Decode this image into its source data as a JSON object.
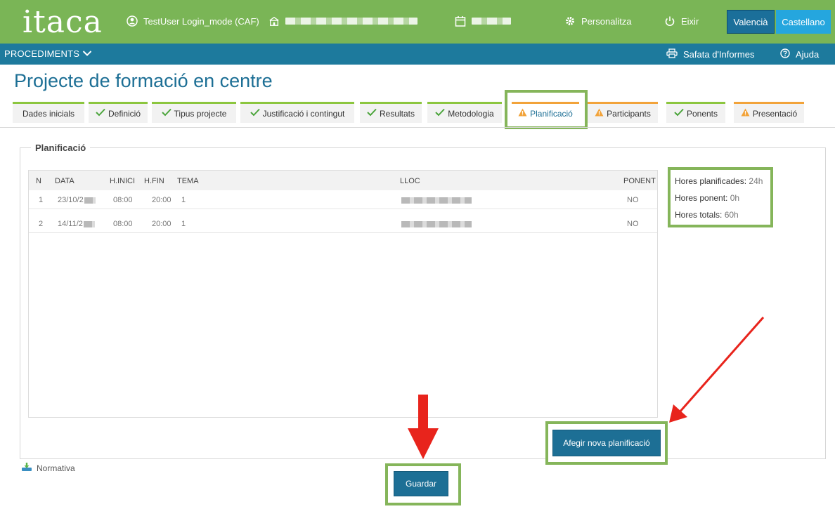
{
  "header": {
    "logo": "itaca",
    "user": "TestUser Login_mode (CAF)",
    "personalize": "Personalitza",
    "exit": "Eixir",
    "lang_valencia": "Valencià",
    "lang_castellano": "Castellano"
  },
  "nav": {
    "procediments": "PROCEDIMENTS",
    "reports": "Safata d'Informes",
    "help": "Ajuda"
  },
  "page": {
    "title": "Projecte de formació en centre"
  },
  "tabs": [
    {
      "label": "Dades inicials",
      "status": "none"
    },
    {
      "label": "Definició",
      "status": "ok"
    },
    {
      "label": "Tipus projecte",
      "status": "ok"
    },
    {
      "label": "Justificació i contingut",
      "status": "ok"
    },
    {
      "label": "Resultats",
      "status": "ok"
    },
    {
      "label": "Metodologia",
      "status": "ok"
    },
    {
      "label": "Planificació",
      "status": "warn",
      "active": true
    },
    {
      "label": "Participants",
      "status": "warn"
    },
    {
      "label": "Ponents",
      "status": "ok"
    },
    {
      "label": "Presentació",
      "status": "warn"
    }
  ],
  "planificacio": {
    "legend": "Planificació",
    "columns": [
      "N",
      "DATA",
      "H.INICI",
      "H.FIN",
      "TEMA",
      "LLOC",
      "PONENT"
    ],
    "rows": [
      {
        "n": "1",
        "data": "23/10/2",
        "inici": "08:00",
        "fin": "20:00",
        "tema": "1",
        "ponent": "NO"
      },
      {
        "n": "2",
        "data": "14/11/2",
        "inici": "08:00",
        "fin": "20:00",
        "tema": "1",
        "ponent": "NO"
      }
    ]
  },
  "summary": {
    "planned_label": "Hores planificades:",
    "planned_value": "24h",
    "ponent_label": "Hores ponent:",
    "ponent_value": "0h",
    "total_label": "Hores totals:",
    "total_value": "60h"
  },
  "buttons": {
    "add": "Afegir nova planificació",
    "save": "Guardar"
  },
  "footer": {
    "normativa": "Normativa"
  },
  "colors": {
    "header_green": "#7ab556",
    "nav_blue": "#1d7a9d",
    "accent_blue": "#1d6f95",
    "highlight_green": "#85b55a",
    "warning_orange": "#f2a33a",
    "arrow_red": "#e8241c"
  }
}
